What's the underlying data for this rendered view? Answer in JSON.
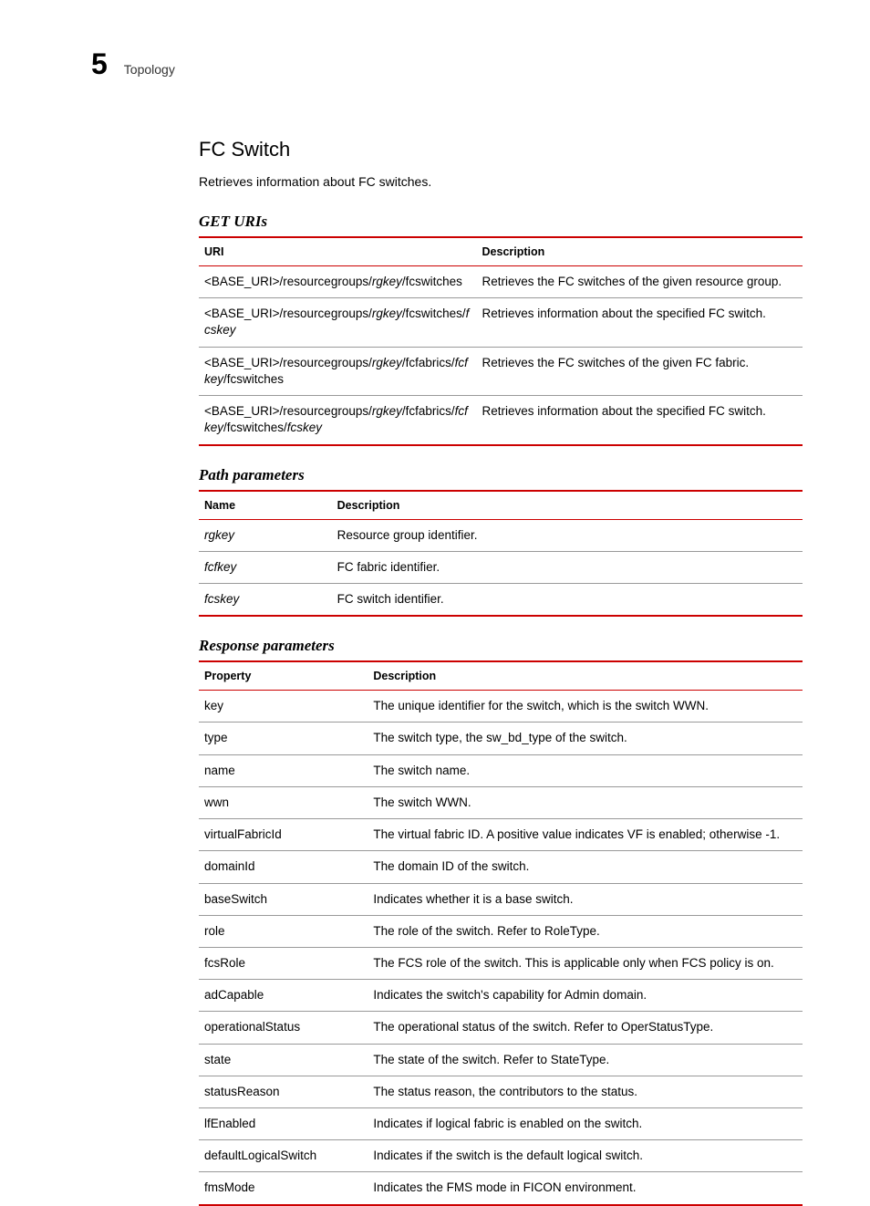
{
  "header": {
    "chapter_number": "5",
    "breadcrumb": "Topology"
  },
  "section": {
    "title": "FC Switch",
    "description": "Retrieves information about FC switches."
  },
  "get_uris": {
    "title": "GET URIs",
    "headers": {
      "col1": "URI",
      "col2": "Description"
    },
    "rows": [
      {
        "uri_parts": [
          "<BASE_URI>/resourcegroups/",
          "rgkey",
          "/fcswitches"
        ],
        "desc": "Retrieves the FC switches of the given resource group."
      },
      {
        "uri_parts": [
          "<BASE_URI>/resourcegroups/",
          "rgkey",
          "/fcswitches/",
          "fcskey"
        ],
        "desc": "Retrieves information about the specified FC switch."
      },
      {
        "uri_parts": [
          "<BASE_URI>/resourcegroups/",
          "rgkey",
          "/fcfabrics/",
          "fcfkey",
          "/fcswitches"
        ],
        "desc": "Retrieves the FC switches of the given FC fabric."
      },
      {
        "uri_parts": [
          "<BASE_URI>/resourcegroups/",
          "rgkey",
          "/fcfabrics/",
          "fcfkey",
          "/fcswitches/",
          "fcskey"
        ],
        "desc": "Retrieves information about the specified FC switch."
      }
    ]
  },
  "path_params": {
    "title": "Path parameters",
    "headers": {
      "col1": "Name",
      "col2": "Description"
    },
    "rows": [
      {
        "name": "rgkey",
        "desc": "Resource group identifier."
      },
      {
        "name": "fcfkey",
        "desc": "FC fabric identifier."
      },
      {
        "name": "fcskey",
        "desc": "FC switch identifier."
      }
    ]
  },
  "response_params": {
    "title": "Response parameters",
    "headers": {
      "col1": "Property",
      "col2": "Description"
    },
    "rows": [
      {
        "prop": "key",
        "desc": "The unique identifier for the switch, which is the switch WWN."
      },
      {
        "prop": "type",
        "desc": "The switch type, the sw_bd_type of the switch."
      },
      {
        "prop": "name",
        "desc": "The switch name."
      },
      {
        "prop": "wwn",
        "desc": "The switch WWN."
      },
      {
        "prop": "virtualFabricId",
        "desc": "The virtual fabric ID. A positive value indicates VF is enabled; otherwise -1."
      },
      {
        "prop": "domainId",
        "desc": "The domain ID of the switch."
      },
      {
        "prop": "baseSwitch",
        "desc": "Indicates whether it is a base switch."
      },
      {
        "prop": "role",
        "desc": "The role of the switch. Refer to RoleType."
      },
      {
        "prop": "fcsRole",
        "desc": "The FCS role of the switch. This is applicable only when FCS policy is on."
      },
      {
        "prop": "adCapable",
        "desc": "Indicates the switch's capability for Admin domain."
      },
      {
        "prop": "operationalStatus",
        "desc": "The operational status of the switch. Refer to OperStatusType."
      },
      {
        "prop": "state",
        "desc": "The state of the switch. Refer to StateType."
      },
      {
        "prop": "statusReason",
        "desc": "The status reason, the contributors to the status."
      },
      {
        "prop": "lfEnabled",
        "desc": "Indicates if logical fabric is enabled on the switch."
      },
      {
        "prop": "defaultLogicalSwitch",
        "desc": "Indicates if the switch is the default logical switch."
      },
      {
        "prop": "fmsMode",
        "desc": "Indicates the FMS mode in FICON environment."
      }
    ]
  }
}
